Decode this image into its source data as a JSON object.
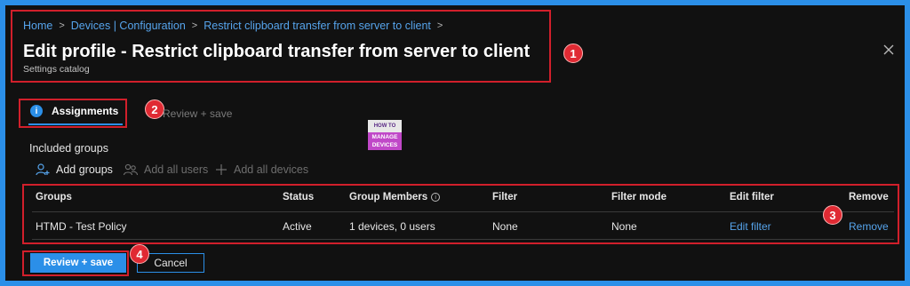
{
  "breadcrumb": {
    "items": [
      "Home",
      "Devices | Configuration",
      "Restrict clipboard transfer from server to client"
    ]
  },
  "header": {
    "title": "Edit profile - Restrict clipboard transfer from server to client",
    "subtitle": "Settings catalog"
  },
  "tabs": [
    {
      "label": "Assignments",
      "active": true
    },
    {
      "label": "Review + save",
      "active": false
    }
  ],
  "logo": {
    "line1": "HOW TO",
    "line2": "MANAGE",
    "line3": "DEVICES"
  },
  "assignments": {
    "section_label": "Included groups",
    "actions": {
      "add_groups": "Add groups",
      "add_all_users": "Add all users",
      "add_all_devices": "Add all devices"
    },
    "table": {
      "columns": [
        "Groups",
        "Status",
        "Group Members",
        "Filter",
        "Filter mode",
        "Edit filter",
        "Remove"
      ],
      "rows": [
        [
          "HTMD - Test Policy",
          "Active",
          "1 devices, 0 users",
          "None",
          "None",
          "Edit filter",
          "Remove"
        ]
      ]
    }
  },
  "footer": {
    "primary_label": "Review + save",
    "secondary_label": "Cancel"
  },
  "annotations": [
    "1",
    "2",
    "3",
    "4"
  ],
  "colors": {
    "accent": "#2b8fe8",
    "highlight": "#d11f2b",
    "background": "#111111"
  }
}
